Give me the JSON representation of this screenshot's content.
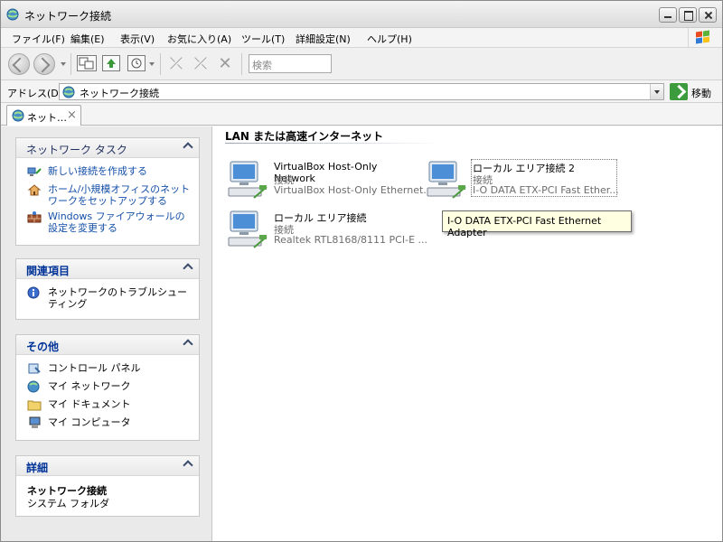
{
  "window": {
    "title": "ネットワーク接続"
  },
  "menu": [
    "ファイル(F)",
    "編集(E)",
    "表示(V)",
    "お気に入り(A)",
    "ツール(T)",
    "詳細設定(N)",
    "ヘルプ(H)"
  ],
  "toolbar": {
    "search_placeholder": "検索"
  },
  "address": {
    "label": "アドレス(D)",
    "value": "ネットワーク接続",
    "go_label": "移動"
  },
  "tab": {
    "label": "ネット…",
    "close": "×"
  },
  "sidebar": {
    "network_tasks": {
      "title": "ネットワーク タスク",
      "items": [
        {
          "label": "新しい接続を作成する",
          "icon": "new-connection-icon"
        },
        {
          "label": "ホーム/小規模オフィスのネットワークをセットアップする",
          "icon": "home-network-icon"
        },
        {
          "label": "Windows ファイアウォールの設定を変更する",
          "icon": "firewall-icon"
        }
      ]
    },
    "related": {
      "title": "関連項目",
      "items": [
        {
          "label": "ネットワークのトラブルシューティング",
          "icon": "info-icon"
        }
      ]
    },
    "other": {
      "title": "その他",
      "items": [
        {
          "label": "コントロール パネル",
          "icon": "control-panel-icon"
        },
        {
          "label": "マイ ネットワーク",
          "icon": "my-network-icon"
        },
        {
          "label": "マイ ドキュメント",
          "icon": "folder-icon"
        },
        {
          "label": "マイ コンピュータ",
          "icon": "computer-icon"
        }
      ]
    },
    "details": {
      "title": "詳細",
      "name": "ネットワーク接続",
      "type": "システム フォルダ"
    }
  },
  "main": {
    "group_title": "LAN または高速インターネット",
    "connections": [
      {
        "name": "VirtualBox Host-Only Network",
        "status": "接続",
        "device": "VirtualBox Host-Only Ethernet..."
      },
      {
        "name": "ローカル エリア接続 2",
        "status": "接続",
        "device": "I-O DATA ETX-PCI Fast Ether..."
      },
      {
        "name": "ローカル エリア接続",
        "status": "接続",
        "device": "Realtek RTL8168/8111 PCI-E ..."
      }
    ],
    "tooltip": "I-O DATA ETX-PCI Fast Ethernet Adapter"
  },
  "colors": {
    "link": "#1550a8",
    "heading": "#003399",
    "tooltip_bg": "#ffffe1"
  }
}
